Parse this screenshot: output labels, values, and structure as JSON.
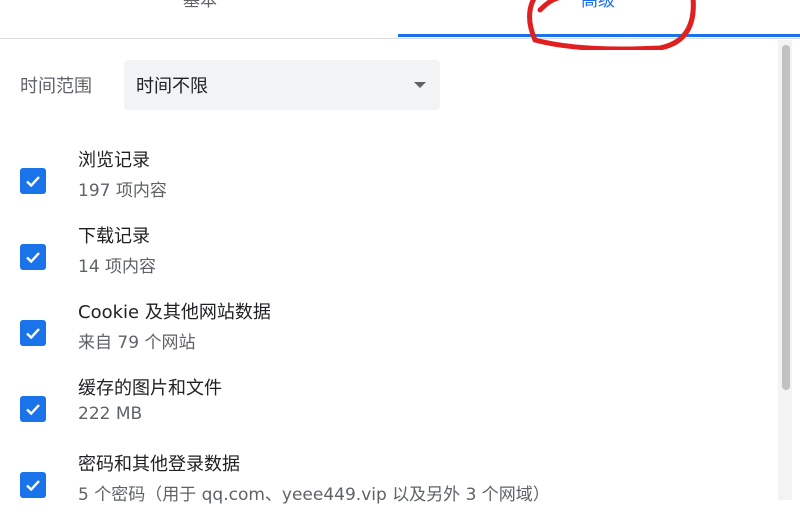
{
  "tabs": {
    "basic_label": "基本",
    "advanced_label": "高级",
    "accent_color": "#1a73e8"
  },
  "time_range": {
    "label": "时间范围",
    "selected": "时间不限"
  },
  "items": [
    {
      "title": "浏览记录",
      "subtitle": "197 项内容",
      "checked": true
    },
    {
      "title": "下载记录",
      "subtitle": "14 项内容",
      "checked": true
    },
    {
      "title": "Cookie 及其他网站数据",
      "subtitle": "来自 79 个网站",
      "checked": true
    },
    {
      "title": "缓存的图片和文件",
      "subtitle": "222 MB",
      "checked": true
    },
    {
      "title": "密码和其他登录数据",
      "subtitle": "5 个密码（用于 qq.com、yeee449.vip 以及另外 3 个网域）",
      "checked": true
    }
  ],
  "icons": {
    "checkbox": "checkmark-icon",
    "dropdown": "caret-down-icon"
  }
}
